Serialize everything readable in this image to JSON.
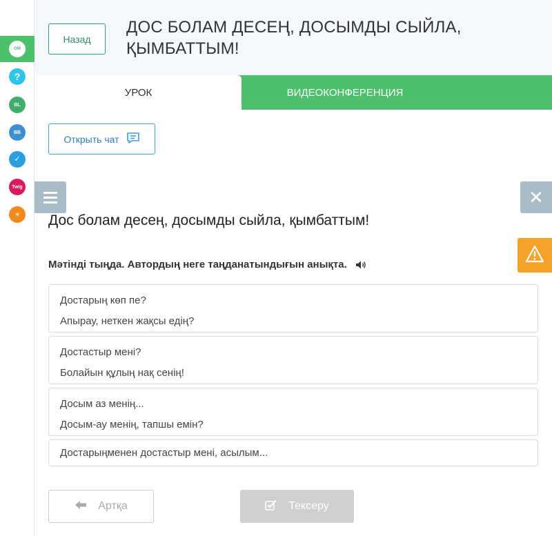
{
  "rail": {
    "items": [
      {
        "name": "onlinemektep",
        "label": "Online Mektep",
        "color": "#ffffff",
        "text_color": "#4cc06a"
      },
      {
        "name": "help",
        "label": "?",
        "color": "#2fc4e8",
        "text_color": "#ffffff"
      },
      {
        "name": "bilimland",
        "label": "Bilim Land",
        "color": "#3fae6a",
        "text_color": "#ffffff"
      },
      {
        "name": "bilimbook",
        "label": "Bilim Book",
        "color": "#3d8fd0",
        "text_color": "#ffffff"
      },
      {
        "name": "test",
        "label": "Test",
        "color": "#2a9fe0",
        "text_color": "#ffffff"
      },
      {
        "name": "twig",
        "label": "Twig",
        "color": "#d8195e",
        "text_color": "#ffffff"
      },
      {
        "name": "imagine",
        "label": "Imagine",
        "color": "#f08a1c",
        "text_color": "#ffffff"
      }
    ]
  },
  "header": {
    "back_label": "Назад",
    "title": "ДОС БОЛАМ ДЕСЕҢ, ДОСЫМДЫ СЫЙЛА, ҚЫМБАТТЫМ!"
  },
  "tabs": {
    "lesson": "УРОК",
    "video": "ВИДЕОКОНФЕРЕНЦИЯ"
  },
  "chat": {
    "label": "Открыть чат"
  },
  "lesson": {
    "title": "Дос болам десең, досымды сыйла, қымбаттым!",
    "instruction": "Мәтінді тыңда. Автордың неге таңданатындығын анықта."
  },
  "options": [
    {
      "line1": "Достарың көп пе?",
      "line2": "Апырау, неткен жақсы едің?"
    },
    {
      "line1": "Достастыр мені?",
      "line2": "Болайын құлың нақ сенің!"
    },
    {
      "line1": "Досым аз менің...",
      "line2": "Досым-ау менің, тапшы емін?"
    },
    {
      "line1": "Достарыңменен достастыр мені, асылым...",
      "line2": ""
    }
  ],
  "footer": {
    "prev_label": "Артқа",
    "check_label": "Тексеру"
  },
  "colors": {
    "accent_green": "#4cc06a",
    "warning": "#f4a228",
    "side_button": "#a9bcc8"
  }
}
